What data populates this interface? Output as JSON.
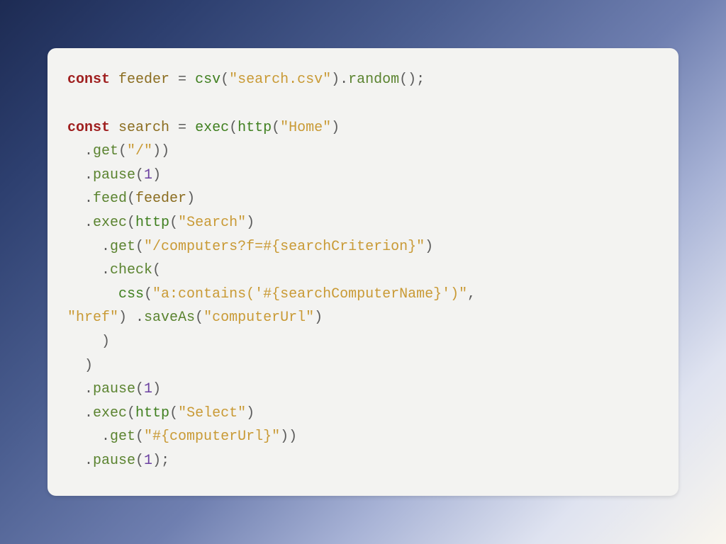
{
  "tokens": [
    {
      "c": "kw",
      "t": "const"
    },
    {
      "c": "pun",
      "t": " "
    },
    {
      "c": "id",
      "t": "feeder"
    },
    {
      "c": "pun",
      "t": " = "
    },
    {
      "c": "fn",
      "t": "csv"
    },
    {
      "c": "pun",
      "t": "("
    },
    {
      "c": "str",
      "t": "\"search.csv\""
    },
    {
      "c": "pun",
      "t": ")."
    },
    {
      "c": "mth",
      "t": "random"
    },
    {
      "c": "pun",
      "t": "();"
    },
    {
      "c": "nl"
    },
    {
      "c": "nl"
    },
    {
      "c": "kw",
      "t": "const"
    },
    {
      "c": "pun",
      "t": " "
    },
    {
      "c": "id",
      "t": "search"
    },
    {
      "c": "pun",
      "t": " = "
    },
    {
      "c": "fn",
      "t": "exec"
    },
    {
      "c": "pun",
      "t": "("
    },
    {
      "c": "fn",
      "t": "http"
    },
    {
      "c": "pun",
      "t": "("
    },
    {
      "c": "str",
      "t": "\"Home\""
    },
    {
      "c": "pun",
      "t": ")"
    },
    {
      "c": "nl"
    },
    {
      "c": "pun",
      "t": "  ."
    },
    {
      "c": "mth",
      "t": "get"
    },
    {
      "c": "pun",
      "t": "("
    },
    {
      "c": "str",
      "t": "\"/\""
    },
    {
      "c": "pun",
      "t": "))"
    },
    {
      "c": "nl"
    },
    {
      "c": "pun",
      "t": "  ."
    },
    {
      "c": "mth",
      "t": "pause"
    },
    {
      "c": "pun",
      "t": "("
    },
    {
      "c": "num",
      "t": "1"
    },
    {
      "c": "pun",
      "t": ")"
    },
    {
      "c": "nl"
    },
    {
      "c": "pun",
      "t": "  ."
    },
    {
      "c": "mth",
      "t": "feed"
    },
    {
      "c": "pun",
      "t": "("
    },
    {
      "c": "id",
      "t": "feeder"
    },
    {
      "c": "pun",
      "t": ")"
    },
    {
      "c": "nl"
    },
    {
      "c": "pun",
      "t": "  ."
    },
    {
      "c": "mth",
      "t": "exec"
    },
    {
      "c": "pun",
      "t": "("
    },
    {
      "c": "fn",
      "t": "http"
    },
    {
      "c": "pun",
      "t": "("
    },
    {
      "c": "str",
      "t": "\"Search\""
    },
    {
      "c": "pun",
      "t": ")"
    },
    {
      "c": "nl"
    },
    {
      "c": "pun",
      "t": "    ."
    },
    {
      "c": "mth",
      "t": "get"
    },
    {
      "c": "pun",
      "t": "("
    },
    {
      "c": "str",
      "t": "\"/computers?f=#{searchCriterion}\""
    },
    {
      "c": "pun",
      "t": ")"
    },
    {
      "c": "nl"
    },
    {
      "c": "pun",
      "t": "    ."
    },
    {
      "c": "mth",
      "t": "check"
    },
    {
      "c": "pun",
      "t": "("
    },
    {
      "c": "nl"
    },
    {
      "c": "pun",
      "t": "      "
    },
    {
      "c": "fn",
      "t": "css"
    },
    {
      "c": "pun",
      "t": "("
    },
    {
      "c": "str",
      "t": "\"a:contains('#{searchComputerName}')\""
    },
    {
      "c": "pun",
      "t": ","
    },
    {
      "c": "nl"
    },
    {
      "c": "str",
      "t": "\"href\""
    },
    {
      "c": "pun",
      "t": ") ."
    },
    {
      "c": "mth",
      "t": "saveAs"
    },
    {
      "c": "pun",
      "t": "("
    },
    {
      "c": "str",
      "t": "\"computerUrl\""
    },
    {
      "c": "pun",
      "t": ")"
    },
    {
      "c": "nl"
    },
    {
      "c": "pun",
      "t": "    )"
    },
    {
      "c": "nl"
    },
    {
      "c": "pun",
      "t": "  )"
    },
    {
      "c": "nl"
    },
    {
      "c": "pun",
      "t": "  ."
    },
    {
      "c": "mth",
      "t": "pause"
    },
    {
      "c": "pun",
      "t": "("
    },
    {
      "c": "num",
      "t": "1"
    },
    {
      "c": "pun",
      "t": ")"
    },
    {
      "c": "nl"
    },
    {
      "c": "pun",
      "t": "  ."
    },
    {
      "c": "mth",
      "t": "exec"
    },
    {
      "c": "pun",
      "t": "("
    },
    {
      "c": "fn",
      "t": "http"
    },
    {
      "c": "pun",
      "t": "("
    },
    {
      "c": "str",
      "t": "\"Select\""
    },
    {
      "c": "pun",
      "t": ")"
    },
    {
      "c": "nl"
    },
    {
      "c": "pun",
      "t": "    ."
    },
    {
      "c": "mth",
      "t": "get"
    },
    {
      "c": "pun",
      "t": "("
    },
    {
      "c": "str",
      "t": "\"#{computerUrl}\""
    },
    {
      "c": "pun",
      "t": "))"
    },
    {
      "c": "nl"
    },
    {
      "c": "pun",
      "t": "  ."
    },
    {
      "c": "mth",
      "t": "pause"
    },
    {
      "c": "pun",
      "t": "("
    },
    {
      "c": "num",
      "t": "1"
    },
    {
      "c": "pun",
      "t": ");"
    }
  ]
}
